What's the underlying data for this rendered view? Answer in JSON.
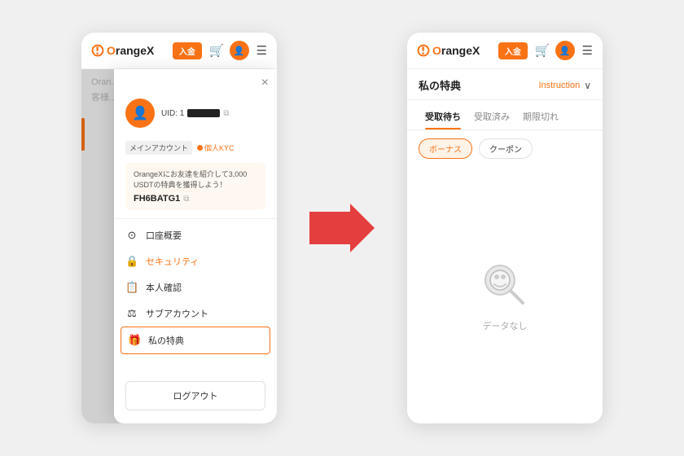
{
  "app": {
    "logo_text": "rangeX",
    "logo_o": "O",
    "deposit_btn": "入金",
    "header_icons": [
      "🛒",
      "☰"
    ]
  },
  "left_panel": {
    "close_label": "×",
    "profile": {
      "uid_prefix": "UID: 1",
      "copy_label": "⧉"
    },
    "kyc_section": {
      "main_account_label": "メインアカウント",
      "kyc_badge": "個人KYC"
    },
    "referral": {
      "text": "OrangeXにお友達を紹介して3,000 USDTの特典を獲得しよう！",
      "code": "FH6BATG1",
      "copy_icon": "⧉"
    },
    "menu_items": [
      {
        "id": "account_overview",
        "icon": "○",
        "label": "口座概要"
      },
      {
        "id": "security",
        "icon": "🔒",
        "label": "セキュリティ",
        "active": true
      },
      {
        "id": "kyc",
        "icon": "📋",
        "label": "本人確認"
      },
      {
        "id": "sub_account",
        "icon": "⚖",
        "label": "サブアカウント"
      },
      {
        "id": "my_benefits",
        "icon": "🎁",
        "label": "私の特典",
        "highlighted": true
      }
    ],
    "logout_btn": "ログアウト"
  },
  "right_panel": {
    "title": "私の特典",
    "instruction_link": "Instruction",
    "tabs": [
      {
        "id": "pending",
        "label": "受取待ち",
        "active": true
      },
      {
        "id": "received",
        "label": "受取済み"
      },
      {
        "id": "expired",
        "label": "期限切れ"
      }
    ],
    "filters": [
      {
        "id": "bonus",
        "label": "ボーナス",
        "active": true
      },
      {
        "id": "coupon",
        "label": "クーポン"
      }
    ],
    "empty_state": {
      "label": "データなし"
    }
  },
  "arrow": {
    "color": "#e53e3e"
  }
}
